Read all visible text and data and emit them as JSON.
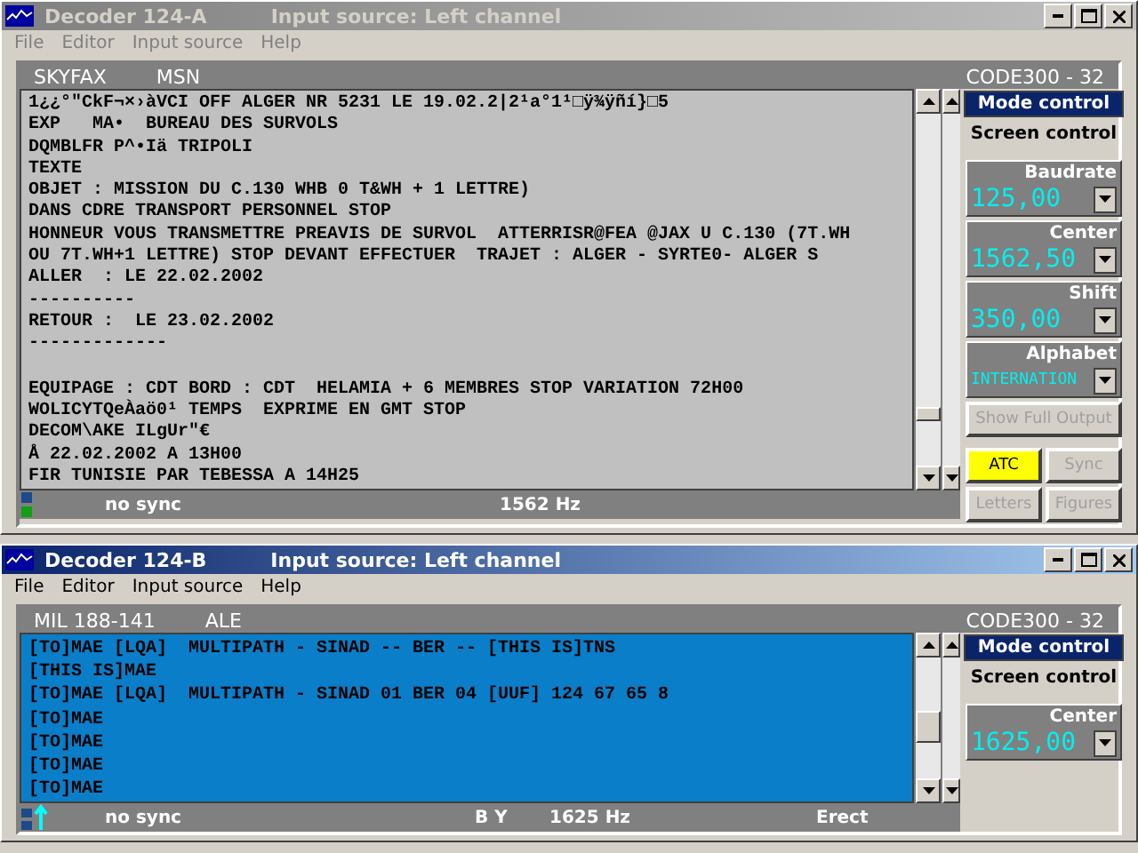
{
  "windows": [
    {
      "kind": "fax",
      "title": "Decoder 124-A",
      "input_source": "Input source: Left channel",
      "menu": [
        "File",
        "Editor",
        "Input source",
        "Help"
      ],
      "mode": [
        "SKYFAX",
        "MSN"
      ],
      "code": "CODE300 - 32",
      "blocks": [
        [
          "1¿¿°\"CkF¬×›àVCI OFF ALGER NR 5231 LE 19.02.2|2¹a°1¹□ÿ¾ÿñí}□5",
          "EXP   MA•  BUREAU DES SURVOLS",
          "DQMBLFR P^•Iä TRIPOLI",
          "TEXTE",
          "OBJET : MISSION DU C.130 WHB 0 T&WH + 1 LETTRE)",
          "DANS CDRE TRANSPORT PERSONNEL STOP",
          "HONNEUR VOUS TRANSMETTRE PREAVIS DE SURVOL  ATTERRISR@FEA @JAX U C.130 (7T.WH",
          "OU 7T.WH+1 LETTRE) STOP DEVANT EFFECTUER  TRAJET : ALGER - SYRTE0- ALGER S",
          "ALLER  : LE 22.02.2002",
          "----------",
          "RETOUR :  LE 23.02.2002",
          "-------------"
        ],
        [
          "EQUIPAGE : CDT BORD : CDT  HELAMIA + 6 MEMBRES STOP VARIATION 72H00",
          "WOLICYTQeÀaö0¹ TEMPS  EXPRIME EN GMT STOP",
          "DECOM\\AKE ILgUr\"€",
          "Å 22.02.2002 A 13H00",
          "FIR TUNISIE PAR TEBESSA A 14H25"
        ]
      ],
      "side_tabs": [
        {
          "label": "Mode control",
          "selected": true
        },
        {
          "label": "Screen control",
          "selected": false
        }
      ],
      "params": [
        {
          "label": "Baudrate",
          "value": "125,00"
        },
        {
          "label": "Center",
          "value": "1562,50"
        },
        {
          "label": "Shift",
          "value": "350,00"
        },
        {
          "label": "Alphabet",
          "value": "INTERNATION"
        }
      ],
      "buttons": [
        {
          "label": "Show Full Output",
          "selected": false
        },
        {
          "label": "ATC",
          "selected": true
        },
        {
          "label": "Sync",
          "selected": false
        },
        {
          "label": "Letters",
          "selected": false
        },
        {
          "label": "Figures",
          "selected": false
        }
      ],
      "status": {
        "sync": "no sync",
        "frequency": "1562 Hz"
      }
    },
    {
      "kind": "ale",
      "title": "Decoder 124-B",
      "input_source": "Input source: Left channel",
      "menu": [
        "File",
        "Editor",
        "Input source",
        "Help"
      ],
      "mode": [
        "MIL 188-141",
        "ALE"
      ],
      "code": "CODE300 - 32",
      "blocks": [
        [
          "[TO]MAE [LQA]  MULTIPATH - SINAD -- BER -- [THIS IS]TNS",
          "[THIS IS]MAE",
          "[TO]MAE [LQA]  MULTIPATH - SINAD 01 BER 04 [UUF] 124 67 65 8",
          "[TO]MAE",
          "[TO]MAE",
          "[TO]MAE",
          "[TO]MAE"
        ]
      ],
      "side_tabs": [
        {
          "label": "Mode control",
          "selected": true
        },
        {
          "label": "Screen control",
          "selected": false
        }
      ],
      "params": [
        {
          "label": "Center",
          "value": "1625,00"
        }
      ],
      "status": {
        "sync": "no sync",
        "pattern": "B Y",
        "frequency": "1625 Hz",
        "polarity": "Erect"
      }
    }
  ]
}
